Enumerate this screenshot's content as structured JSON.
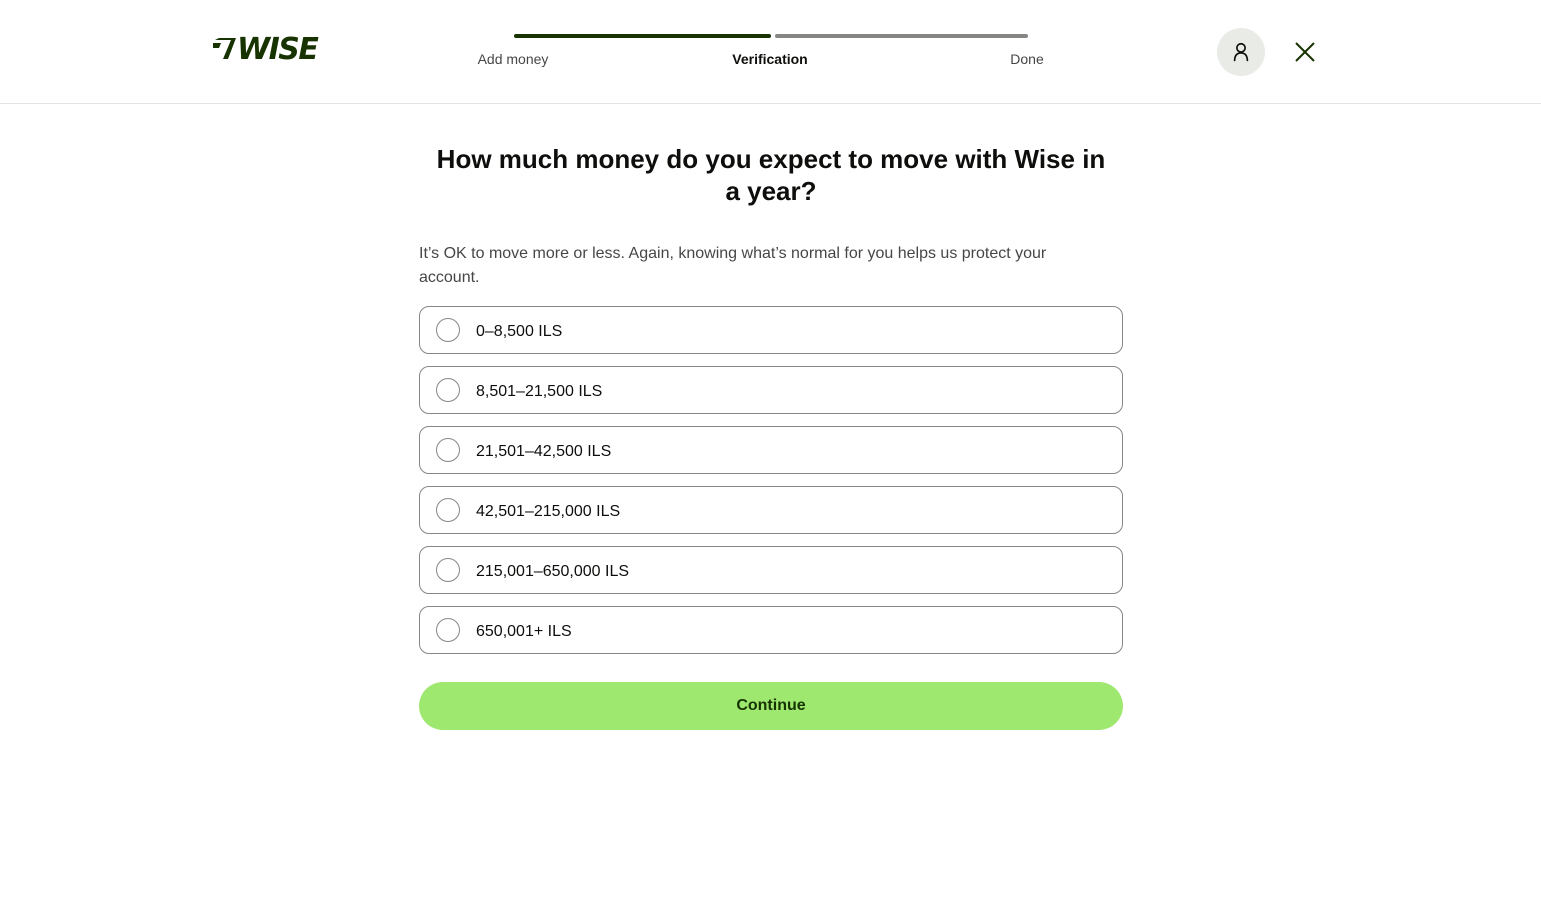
{
  "header": {
    "logo_text": "7WISE",
    "steps": [
      {
        "label": "Add money",
        "state": "complete"
      },
      {
        "label": "Verification",
        "state": "active"
      },
      {
        "label": "Done",
        "state": "upcoming"
      }
    ],
    "icons": {
      "account": "person-icon",
      "close": "close-icon"
    }
  },
  "question": {
    "title": "How much money do you expect to move with Wise in a year?",
    "subtitle": "It’s OK to move more or less. Again, knowing what’s normal for you helps us protect your account."
  },
  "options": [
    {
      "label": "0–8,500 ILS",
      "selected": false
    },
    {
      "label": "8,501–21,500 ILS",
      "selected": false
    },
    {
      "label": "21,501–42,500 ILS",
      "selected": false
    },
    {
      "label": "42,501–215,000 ILS",
      "selected": false
    },
    {
      "label": "215,001–650,000 ILS",
      "selected": false
    },
    {
      "label": "650,001+ ILS",
      "selected": false
    }
  ],
  "actions": {
    "continue_label": "Continue"
  },
  "colors": {
    "brand_dark_green": "#163300",
    "accent_green": "#9fe870",
    "progress_inactive": "#868685",
    "avatar_bg": "#e8ebe6"
  }
}
